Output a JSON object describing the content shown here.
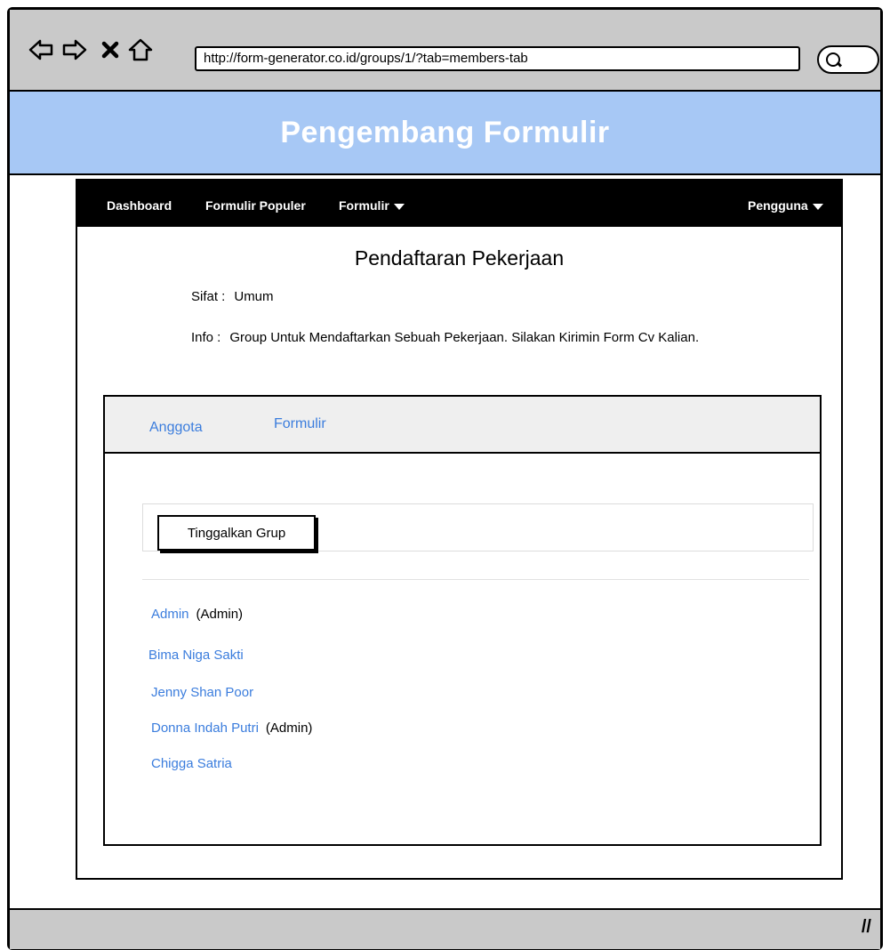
{
  "browser": {
    "url": "http://form-generator.co.id/groups/1/?tab=members-tab",
    "icons": [
      "back-icon",
      "forward-icon",
      "close-icon",
      "home-icon",
      "search-icon"
    ]
  },
  "banner": {
    "title": "Pengembang Formulir"
  },
  "navbar": {
    "items": [
      {
        "label": "Dashboard"
      },
      {
        "label": "Formulir Populer"
      },
      {
        "label": "Formulir"
      }
    ],
    "user_menu": "Pengguna"
  },
  "group": {
    "title": "Pendaftaran Pekerjaan",
    "nature_label": "Sifat :",
    "nature_value": "Umum",
    "info_label": "Info :",
    "info_value": "Group Untuk Mendaftarkan Sebuah Pekerjaan. Silakan Kirimin Form Cv Kalian."
  },
  "tabs": [
    {
      "label": "Anggota"
    },
    {
      "label": "Formulir"
    }
  ],
  "actions": {
    "leave_group": "Tinggalkan Grup"
  },
  "members": [
    {
      "name": "Admin",
      "role": "(Admin)"
    },
    {
      "name": "Bima Niga Sakti",
      "role": ""
    },
    {
      "name": "Jenny Shan Poor",
      "role": ""
    },
    {
      "name": "Donna Indah Putri",
      "role": "(Admin)"
    },
    {
      "name": "Chigga Satria",
      "role": ""
    }
  ],
  "colors": {
    "banner": "#a7c8f5",
    "link": "#3b7ddd",
    "chrome": "#c9c9c9",
    "navbar": "#000000"
  }
}
